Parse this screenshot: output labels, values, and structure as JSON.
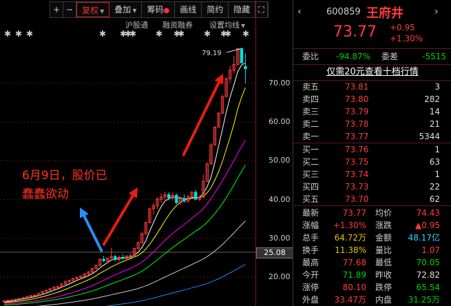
{
  "toolbar": {
    "plus": "+",
    "minus": "−",
    "fuquan": "复权",
    "diejia": "叠加",
    "chouma": "筹码",
    "huaxian": "画线",
    "jianyue": "简约",
    "yincang": "隐藏",
    "expand": "⛶"
  },
  "subbar": {
    "hgt": "沪股通",
    "rzrq": "融资融券",
    "settings": "设置均线"
  },
  "annotations": {
    "high_label": "79.19",
    "note_line1": "6月9日，股价已",
    "note_line2": "蠢蠢欲动",
    "current_price_tag": "25.08"
  },
  "y_axis": {
    "ticks": [
      {
        "label": "70.00",
        "value": 70
      },
      {
        "label": "60.00",
        "value": 60
      },
      {
        "label": "50.00",
        "value": 50
      },
      {
        "label": "40.00",
        "value": 40
      },
      {
        "label": "30.00",
        "value": 30
      },
      {
        "label": "20.00",
        "value": 20
      }
    ]
  },
  "colors": {
    "up": "#ff3b3b",
    "down": "#00e0e0",
    "ma5": "#ffffff",
    "ma10": "#ffff00",
    "ma20": "#ff00ff",
    "ma30": "#00ff00",
    "ma60": "#cccccc",
    "ma120": "#2288ff",
    "grid": "#5a1212",
    "arrow_red": "#e81e10",
    "arrow_blue": "#2a8fff"
  },
  "candles": [
    [
      13.6,
      14.0,
      13.4,
      13.9
    ],
    [
      13.9,
      14.2,
      13.7,
      14.0
    ],
    [
      14.0,
      14.3,
      13.8,
      14.1
    ],
    [
      14.1,
      14.4,
      14.0,
      14.3
    ],
    [
      14.3,
      14.6,
      14.1,
      14.5
    ],
    [
      14.5,
      14.9,
      14.3,
      14.7
    ],
    [
      14.7,
      15.1,
      14.5,
      15.0
    ],
    [
      15.0,
      15.4,
      14.8,
      15.2
    ],
    [
      15.2,
      15.6,
      15.0,
      15.3
    ],
    [
      15.3,
      15.9,
      15.2,
      15.8
    ],
    [
      15.8,
      16.4,
      15.6,
      16.3
    ],
    [
      16.3,
      16.8,
      16.0,
      16.6
    ],
    [
      16.6,
      17.2,
      16.4,
      17.0
    ],
    [
      17.0,
      17.6,
      16.8,
      17.4
    ],
    [
      17.4,
      17.8,
      17.0,
      17.5
    ],
    [
      17.5,
      18.4,
      17.3,
      18.2
    ],
    [
      18.2,
      19.0,
      18.0,
      18.9
    ],
    [
      18.9,
      19.4,
      18.4,
      19.1
    ],
    [
      19.1,
      19.8,
      18.9,
      19.6
    ],
    [
      19.6,
      20.2,
      19.2,
      19.9
    ],
    [
      19.9,
      20.5,
      19.5,
      20.2
    ],
    [
      20.2,
      21.0,
      20.0,
      20.8
    ],
    [
      20.8,
      21.6,
      20.5,
      21.3
    ],
    [
      21.3,
      22.4,
      21.0,
      22.2
    ],
    [
      22.2,
      23.3,
      21.9,
      23.0
    ],
    [
      23.0,
      24.8,
      22.8,
      24.6
    ],
    [
      24.6,
      25.5,
      23.9,
      24.2
    ],
    [
      24.2,
      25.0,
      23.5,
      24.9
    ],
    [
      24.9,
      27.5,
      24.6,
      25.3
    ],
    [
      25.3,
      25.8,
      24.2,
      24.5
    ],
    [
      24.5,
      25.6,
      24.0,
      25.1
    ],
    [
      25.1,
      25.9,
      24.5,
      24.8
    ],
    [
      24.8,
      25.7,
      24.4,
      25.4
    ],
    [
      25.4,
      26.1,
      24.9,
      25.5
    ],
    [
      25.5,
      27.6,
      25.4,
      27.4
    ],
    [
      27.4,
      29.1,
      27.0,
      28.9
    ],
    [
      28.9,
      31.6,
      28.6,
      31.2
    ],
    [
      31.2,
      34.3,
      30.9,
      34.1
    ],
    [
      34.1,
      37.9,
      33.8,
      37.6
    ],
    [
      37.6,
      39.1,
      36.1,
      38.4
    ],
    [
      38.4,
      40.6,
      37.6,
      40.1
    ],
    [
      40.1,
      41.6,
      39.2,
      40.7
    ],
    [
      40.7,
      42.1,
      39.6,
      41.3
    ],
    [
      41.3,
      41.9,
      39.9,
      40.4
    ],
    [
      40.4,
      41.8,
      39.8,
      41.1
    ],
    [
      41.1,
      41.6,
      38.8,
      39.2
    ],
    [
      39.2,
      40.9,
      38.6,
      40.3
    ],
    [
      40.3,
      41.4,
      39.2,
      39.6
    ],
    [
      39.6,
      41.1,
      39.1,
      40.8
    ],
    [
      40.8,
      42.2,
      40.3,
      41.9
    ],
    [
      41.9,
      42.5,
      39.9,
      40.1
    ],
    [
      40.1,
      40.9,
      39.6,
      40.6
    ],
    [
      40.6,
      46.5,
      40.5,
      44.7
    ],
    [
      44.7,
      49.6,
      44.5,
      49.2
    ],
    [
      49.2,
      54.6,
      49.0,
      54.1
    ],
    [
      54.1,
      58.9,
      54.0,
      58.7
    ],
    [
      58.7,
      62.6,
      58.6,
      62.3
    ],
    [
      62.3,
      67.1,
      62.2,
      66.6
    ],
    [
      66.6,
      71.6,
      66.5,
      71.2
    ],
    [
      71.2,
      74.6,
      70.1,
      73.4
    ],
    [
      73.4,
      77.1,
      72.6,
      74.9
    ],
    [
      74.9,
      79.19,
      74.4,
      79.0
    ],
    [
      79.0,
      79.19,
      75.1,
      75.3
    ],
    [
      74.4,
      77.7,
      70.05,
      73.77
    ]
  ],
  "quote": {
    "code": "600859",
    "name": "王府井",
    "price": "73.77",
    "chg": "+0.95",
    "pct": "+1.30%",
    "weibi_label": "委比",
    "weibi": "-94.87%",
    "weicha_label": "委差",
    "weicha": "-5515",
    "promo": "仅需20元查看十档行情",
    "asks": [
      {
        "label": "卖五",
        "price": "73.81",
        "vol": "3"
      },
      {
        "label": "卖四",
        "price": "73.80",
        "vol": "282"
      },
      {
        "label": "卖三",
        "price": "73.79",
        "vol": "14"
      },
      {
        "label": "卖二",
        "price": "73.78",
        "vol": "21"
      },
      {
        "label": "卖一",
        "price": "73.77",
        "vol": "5344"
      }
    ],
    "bids": [
      {
        "label": "买一",
        "price": "73.76",
        "vol": "1"
      },
      {
        "label": "买二",
        "price": "73.75",
        "vol": "63"
      },
      {
        "label": "买三",
        "price": "73.74",
        "vol": "1"
      },
      {
        "label": "买四",
        "price": "73.73",
        "vol": "22"
      },
      {
        "label": "买五",
        "price": "73.70",
        "vol": "62"
      }
    ],
    "stats": [
      {
        "l1": "最新",
        "v1": "73.77",
        "c1": "r",
        "l2": "均价",
        "v2": "74.43",
        "c2": "r"
      },
      {
        "l1": "涨幅",
        "v1": "+1.30%",
        "c1": "r",
        "l2": "涨跌",
        "v2": "▲0.95",
        "c2": "r"
      },
      {
        "l1": "总手",
        "v1": "64.72万",
        "c1": "y",
        "l2": "金额",
        "v2": "48.17亿",
        "c2": "c"
      },
      {
        "l1": "换手",
        "v1": "11.38%",
        "c1": "y",
        "l2": "量比",
        "v2": "1.07",
        "c2": "r"
      },
      {
        "l1": "最高",
        "v1": "77.68",
        "c1": "r",
        "l2": "最低",
        "v2": "70.05",
        "c2": "g"
      },
      {
        "l1": "今开",
        "v1": "71.89",
        "c1": "g",
        "l2": "昨收",
        "v2": "72.82",
        "c2": "w"
      },
      {
        "l1": "涨停",
        "v1": "80.10",
        "c1": "r",
        "l2": "跌停",
        "v2": "65.54",
        "c2": "g"
      },
      {
        "l1": "外盘",
        "v1": "33.47万",
        "c1": "r",
        "l2": "内盘",
        "v2": "31.25万",
        "c2": "g"
      }
    ]
  }
}
